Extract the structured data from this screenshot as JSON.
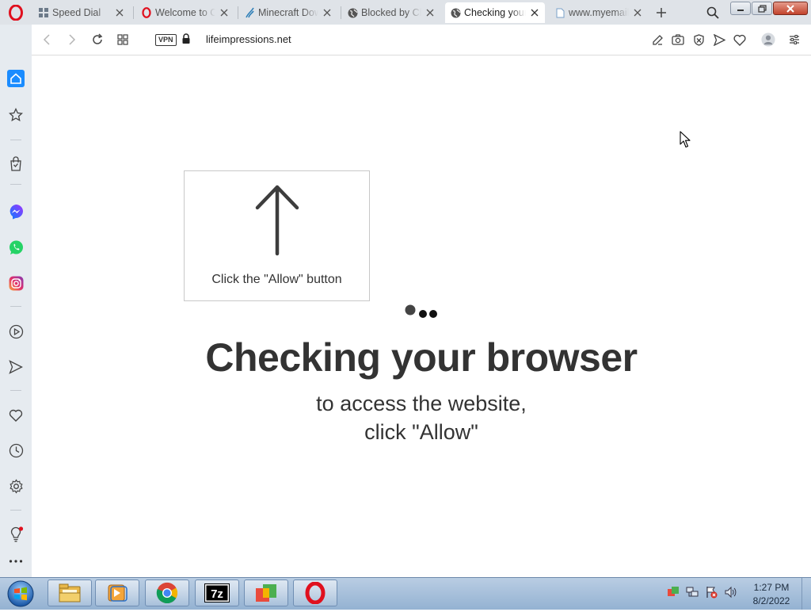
{
  "tabs": [
    {
      "title": "Speed Dial",
      "active": false,
      "icon": "speed-dial-icon"
    },
    {
      "title": "Welcome to Opera",
      "active": false,
      "icon": "opera-icon"
    },
    {
      "title": "Minecraft Download",
      "active": false,
      "icon": "minecraft-icon"
    },
    {
      "title": "Blocked by Chrome",
      "active": false,
      "icon": "globe-icon"
    },
    {
      "title": "Checking your browser",
      "active": true,
      "icon": "globe-icon"
    },
    {
      "title": "www.myemail",
      "active": false,
      "icon": "page-icon"
    }
  ],
  "address_bar": {
    "vpn_label": "VPN",
    "url": "lifeimpressions.net"
  },
  "page": {
    "allow_caption": "Click the \"Allow\" button",
    "heading": "Checking your browser",
    "subtitle_line1": "to access the website,",
    "subtitle_line2": "click \"Allow\""
  },
  "sidebar": {
    "items": [
      "home-icon",
      "star-icon",
      "shopping-bag-icon",
      "messenger-icon",
      "whatsapp-icon",
      "instagram-icon",
      "player-icon",
      "send-icon",
      "heart-icon",
      "history-icon",
      "settings-icon",
      "lightbulb-icon",
      "more-icon"
    ]
  },
  "taskbar": {
    "apps": [
      "file-explorer",
      "media-player",
      "chrome",
      "7-zip",
      "app-launcher",
      "opera"
    ],
    "clock_time": "1:27 PM",
    "clock_date": "8/2/2022"
  },
  "colors": {
    "accent": "#1a8cff",
    "opera_red": "#e0101e",
    "heading": "#333333"
  }
}
